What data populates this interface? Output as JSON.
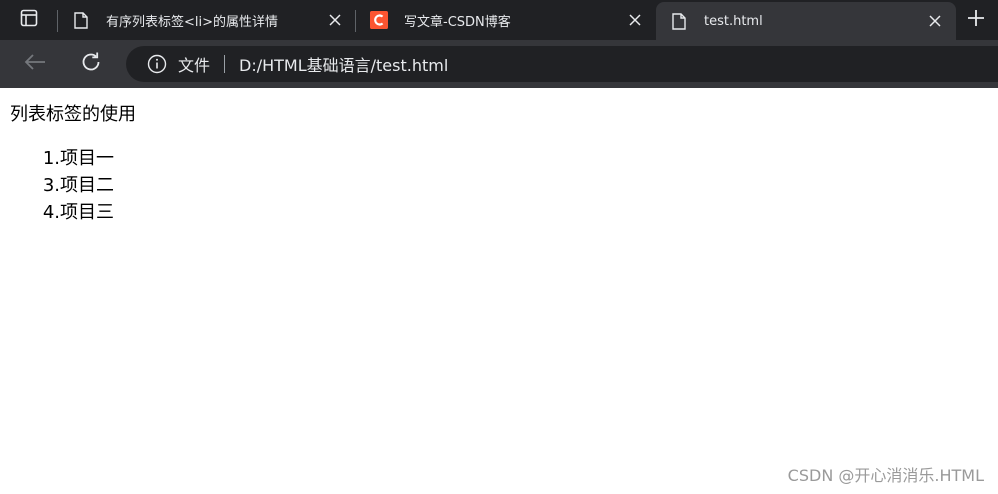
{
  "tabs": [
    {
      "title": "有序列表标签<li>的属性详情",
      "icon": "page-icon",
      "active": false
    },
    {
      "title": "写文章-CSDN博客",
      "icon": "csdn-logo-icon",
      "active": false
    },
    {
      "title": "test.html",
      "icon": "page-icon",
      "active": true
    }
  ],
  "toolbar": {
    "origin_label": "文件",
    "url": "D:/HTML基础语言/test.html"
  },
  "page": {
    "heading": "列表标签的使用",
    "items": [
      {
        "num": "1.",
        "text": "项目一"
      },
      {
        "num": "3.",
        "text": "项目二"
      },
      {
        "num": "4.",
        "text": "项目三"
      }
    ]
  },
  "watermark": "CSDN @开心消消乐.HTML",
  "colors": {
    "tabstrip_bg": "#202124",
    "toolbar_bg": "#35363a",
    "csdn_brand": "#fc5531"
  }
}
